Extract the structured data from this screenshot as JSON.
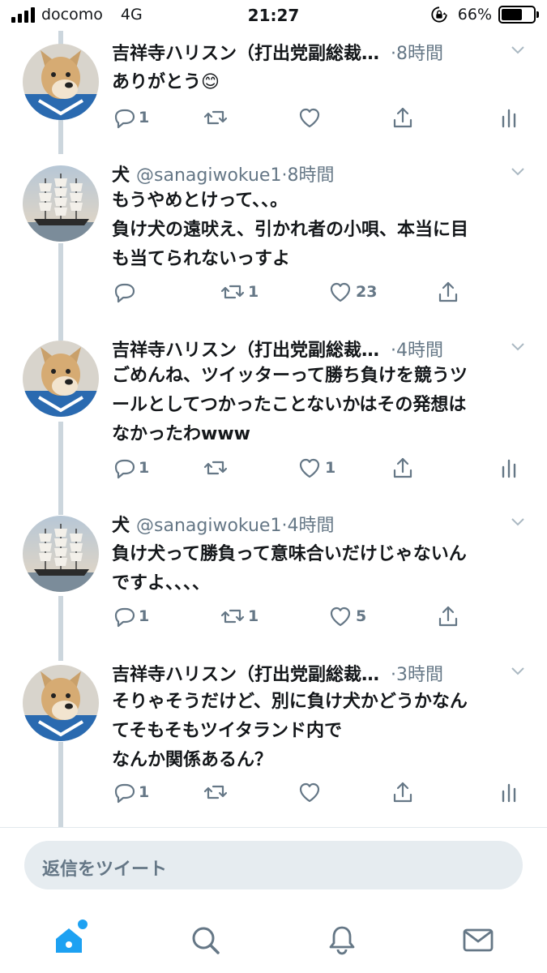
{
  "status_bar": {
    "carrier": "docomo",
    "network": "4G",
    "time": "21:27",
    "battery": "66%",
    "battery_level": 0.66
  },
  "tweets": [
    {
      "name": "吉祥寺ハリスン（打出党副総裁…",
      "handle": "",
      "time": "·8時間",
      "text": "ありがとう😊",
      "avatar": "dog",
      "replies": "1",
      "retweets": "",
      "likes": "",
      "has_analytics": true
    },
    {
      "name": "犬",
      "handle": "@sanagiwokue1",
      "time": "·8時間",
      "text": "もうやめとけって、、。\n負け犬の遠吠え、引かれ者の小唄、本当に目\nも当てられないっすよ",
      "avatar": "ship",
      "replies": "",
      "retweets": "1",
      "likes": "23",
      "has_analytics": false
    },
    {
      "name": "吉祥寺ハリスン（打出党副総裁…",
      "handle": "",
      "time": "·4時間",
      "text": "ごめんね、ツイッターって勝ち負けを競うツ\nールとしてつかったことないかはその発想は\nなかったわwww",
      "avatar": "dog",
      "replies": "1",
      "retweets": "",
      "likes": "1",
      "has_analytics": true
    },
    {
      "name": "犬",
      "handle": "@sanagiwokue1",
      "time": "·4時間",
      "text": "負け犬って勝負って意味合いだけじゃないん\nですよ、、、、",
      "avatar": "ship",
      "replies": "1",
      "retweets": "1",
      "likes": "5",
      "has_analytics": false
    },
    {
      "name": "吉祥寺ハリスン（打出党副総裁…",
      "handle": "",
      "time": "·3時間",
      "text": "そりゃそうだけど、別に負け犬かどうかなん\nてそもそもツイタランド内で\nなんか関係あるん？",
      "avatar": "dog",
      "replies": "1",
      "retweets": "",
      "likes": "",
      "has_analytics": true
    }
  ],
  "reply_bar": {
    "placeholder": "返信をツイート"
  },
  "tab_bar": {
    "items": [
      "home-icon",
      "search-icon",
      "notifications-icon",
      "messages-icon"
    ],
    "active_color": "#1da1f2"
  },
  "colors": {
    "secondary_text": "#657786",
    "thread_line": "#ccd6dd",
    "accent": "#1da1f2"
  }
}
